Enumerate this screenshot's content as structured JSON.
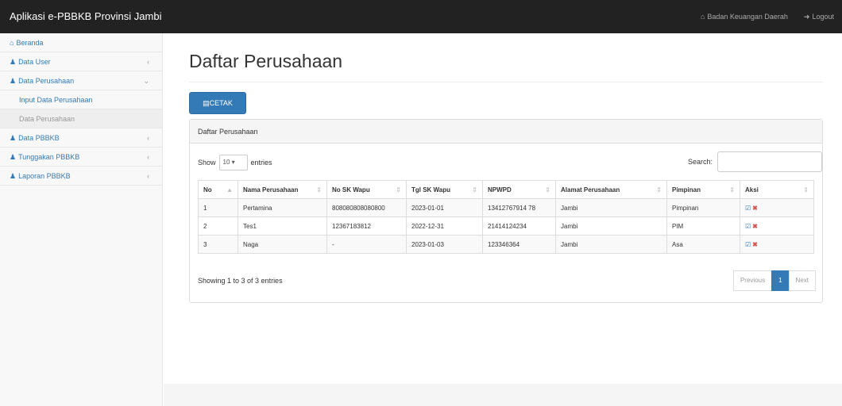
{
  "navbar": {
    "brand": "Aplikasi e-PBBKB Provinsi Jambi",
    "user_label": "Badan Keuangan Daerah",
    "logout_label": "Logout"
  },
  "sidebar": {
    "items": [
      {
        "label": "Beranda"
      },
      {
        "label": "Data User"
      },
      {
        "label": "Data Perusahaan"
      },
      {
        "label": "Input Data Perusahaan"
      },
      {
        "label": "Data Perusahaan"
      },
      {
        "label": "Data PBBKB"
      },
      {
        "label": "Tunggakan PBBKB"
      },
      {
        "label": "Laporan PBBKB"
      }
    ]
  },
  "main": {
    "title": "Daftar Perusahaan",
    "print_label": "CETAK",
    "panel_title": "Daftar Perusahaan",
    "show_label": "Show",
    "entries_value": "10",
    "entries_label": "entries",
    "search_label": "Search:",
    "search_value": "",
    "info": "Showing 1 to 3 of 3 entries",
    "pager": {
      "prev": "Previous",
      "page": "1",
      "next": "Next"
    }
  },
  "table": {
    "headers": [
      "No",
      "Nama Perusahaan",
      "No SK Wapu",
      "Tgl SK Wapu",
      "NPWPD",
      "Alamat Perusahaan",
      "Pimpinan",
      "Aksi"
    ],
    "rows": [
      [
        "1",
        "Pertamina",
        "808080808080800",
        "2023-01-01",
        "13412767914 78",
        "Jambi",
        "Pimpinan"
      ],
      [
        "2",
        "Tes1",
        "12367183812",
        "2022-12-31",
        "21414124234",
        "Jambi",
        "PIM"
      ],
      [
        "3",
        "Naga",
        "-",
        "2023-01-03",
        "123346364",
        "Jambi",
        "Asa"
      ]
    ]
  },
  "colors": {
    "primary": "#337ab7",
    "navbar": "#222222",
    "danger": "#d9534f"
  }
}
